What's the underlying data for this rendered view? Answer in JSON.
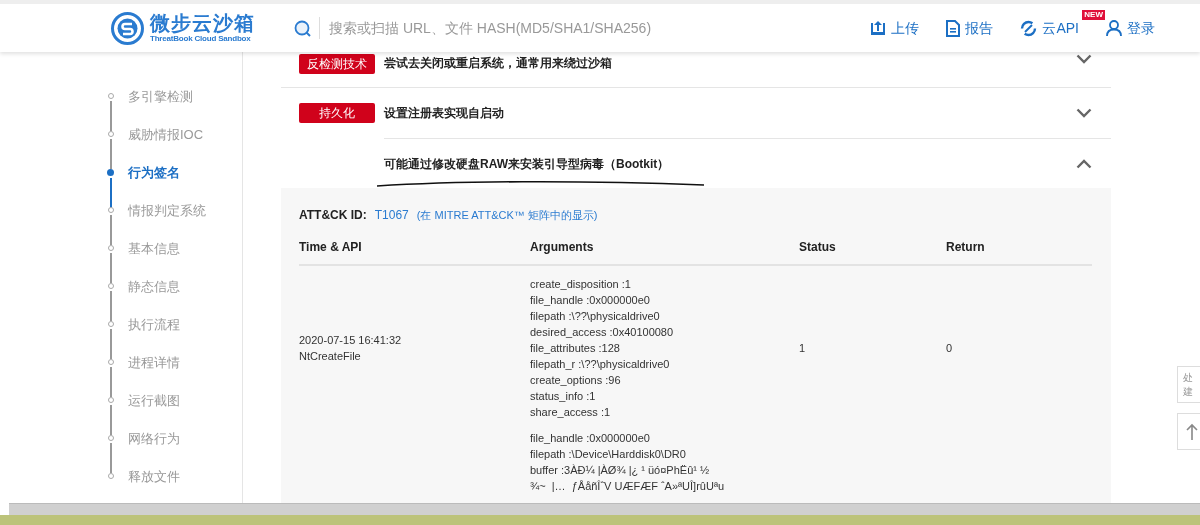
{
  "header": {
    "logo_title": "微步云沙箱",
    "logo_subtitle": "ThreatBook Cloud Sandbox",
    "search": {
      "placeholder": "搜索或扫描 URL、文件 HASH(MD5/SHA1/SHA256)"
    },
    "nav": [
      {
        "kind": "upload",
        "label": "上传"
      },
      {
        "kind": "report",
        "label": "报告"
      },
      {
        "kind": "api",
        "label": "云API",
        "badge": "NEW"
      },
      {
        "kind": "login",
        "label": "登录"
      }
    ]
  },
  "sidebar": {
    "items": [
      {
        "label": "多引擎检测",
        "selected": false
      },
      {
        "label": "威胁情报IOC",
        "selected": false
      },
      {
        "label": "行为签名",
        "selected": true
      },
      {
        "label": "情报判定系统",
        "selected": false
      },
      {
        "label": "基本信息",
        "selected": false
      },
      {
        "label": "静态信息",
        "selected": false
      },
      {
        "label": "执行流程",
        "selected": false
      },
      {
        "label": "进程详情",
        "selected": false
      },
      {
        "label": "运行截图",
        "selected": false
      },
      {
        "label": "网络行为",
        "selected": false
      },
      {
        "label": "释放文件",
        "selected": false
      }
    ]
  },
  "signatures": [
    {
      "tag": "反检测技术",
      "title": "尝试去关闭或重启系统，通常用来绕过沙箱",
      "expanded": false
    },
    {
      "tag": "持久化",
      "title": "设置注册表实现自启动",
      "expanded": false
    },
    {
      "title": "可能通过修改硬盘RAW来安装引导型病毒（Bootkit）",
      "expanded": true
    }
  ],
  "detail": {
    "attck_label": "ATT&CK ID:",
    "attck_id": "T1067",
    "attck_link": "(在 MITRE ATT&CK™ 矩阵中的显示)",
    "columns": [
      "Time & API",
      "Arguments",
      "Status",
      "Return"
    ],
    "rows": [
      {
        "time": "2020-07-15 16:41:32",
        "api": "NtCreateFile",
        "arguments": [
          "create_disposition :1",
          "file_handle :0x000000e0",
          "filepath :\\??\\physicaldrive0",
          "desired_access :0x40100080",
          "file_attributes :128",
          "filepath_r :\\??\\physicaldrive0",
          "create_options :96",
          "status_info :1",
          "share_access :1"
        ],
        "status": "1",
        "return": "0"
      },
      {
        "arguments": [
          "file_handle :0x000000e0",
          "filepath :\\Device\\Harddisk0\\DR0",
          "buffer :3ÀÐ¼ |ÀØ¾ |¿ ¹ üó¤PhËû¹ ½",
          "¾~  |…  ƒÅåñÎˆV UÆFÆF ˆA»ªUÎ]rûUªu"
        ]
      }
    ]
  },
  "float_buttons": [
    {
      "kind": "feedback",
      "lines": [
        "处",
        "建"
      ]
    },
    {
      "kind": "back-to-top"
    }
  ]
}
